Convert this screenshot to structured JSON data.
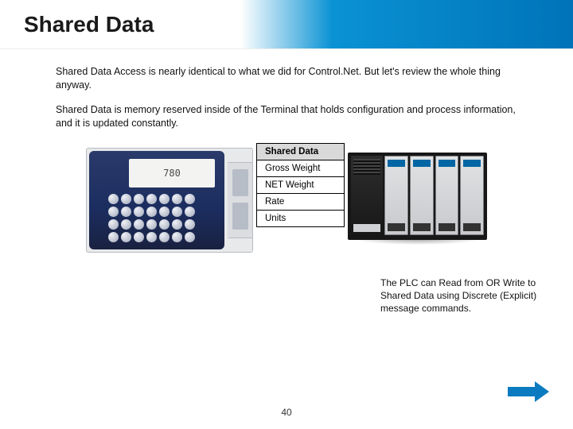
{
  "title": "Shared Data",
  "paragraphs": {
    "p1": "Shared Data Access is nearly identical to what we did for Control.Net.  But let's review the whole thing anyway.",
    "p2": "Shared Data is memory reserved inside of the Terminal that holds configuration and process information, and it is updated constantly."
  },
  "terminal_display": "780",
  "shared_data_table": {
    "header": "Shared Data",
    "rows": [
      "Gross Weight",
      "NET Weight",
      "Rate",
      "Units"
    ]
  },
  "caption": "The PLC can Read from OR Write to Shared Data using Discrete (Explicit) message commands.",
  "page_number": "40"
}
